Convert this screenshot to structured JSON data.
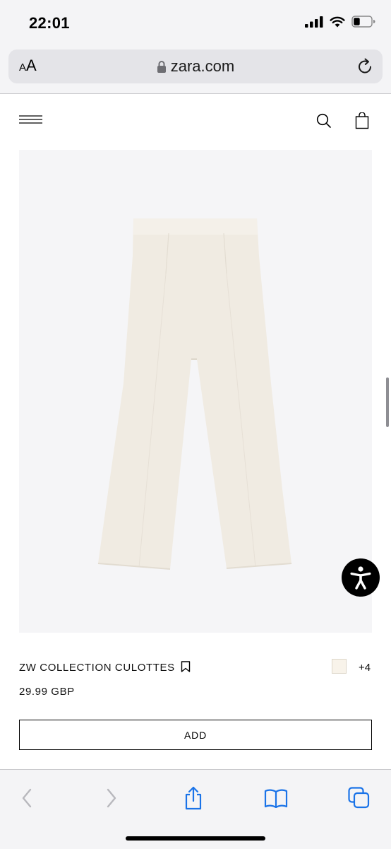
{
  "status_bar": {
    "time": "22:01"
  },
  "browser": {
    "text_size_label_small": "A",
    "text_size_label_large": "A",
    "url": "zara.com"
  },
  "product": {
    "name": "ZW COLLECTION CULOTTES",
    "price": "29.99 GBP",
    "more_colors": "+4",
    "swatch_color": "#f8f3ea",
    "add_label": "ADD"
  },
  "icons": {
    "status": [
      "cellular-signal-icon",
      "wifi-icon",
      "battery-icon"
    ],
    "header": [
      "menu-icon",
      "search-icon",
      "shopping-bag-icon"
    ],
    "toolbar": [
      "back-icon",
      "forward-icon",
      "share-icon",
      "bookmarks-icon",
      "tabs-icon"
    ]
  },
  "colors": {
    "accent": "#1a73e8",
    "toolbar_bg": "#f4f4f6"
  }
}
